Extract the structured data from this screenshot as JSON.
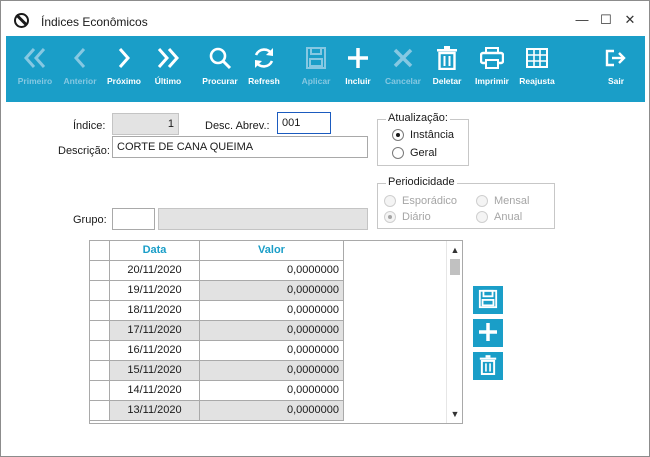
{
  "window": {
    "title": "Índices Econômicos",
    "controls": {
      "minimize": "—",
      "maximize": "☐",
      "close": "✕"
    }
  },
  "toolbar": {
    "items": [
      {
        "label": "Primeiro",
        "icon": "double-chevron-left-icon",
        "enabled": false
      },
      {
        "label": "Anterior",
        "icon": "chevron-left-icon",
        "enabled": false
      },
      {
        "label": "Próximo",
        "icon": "chevron-right-icon",
        "enabled": true
      },
      {
        "label": "Último",
        "icon": "double-chevron-right-icon",
        "enabled": true
      },
      {
        "label": "Procurar",
        "icon": "search-icon",
        "enabled": true
      },
      {
        "label": "Refresh",
        "icon": "refresh-icon",
        "enabled": true
      },
      {
        "label": "Aplicar",
        "icon": "save-icon",
        "enabled": false
      },
      {
        "label": "Incluir",
        "icon": "plus-icon",
        "enabled": true
      },
      {
        "label": "Cancelar",
        "icon": "x-icon",
        "enabled": false
      },
      {
        "label": "Deletar",
        "icon": "trash-icon",
        "enabled": true
      },
      {
        "label": "Imprimir",
        "icon": "printer-icon",
        "enabled": true
      },
      {
        "label": "Reajusta",
        "icon": "grid-icon",
        "enabled": true
      },
      {
        "label": "Sair",
        "icon": "exit-icon",
        "enabled": true
      }
    ]
  },
  "form": {
    "indice_label": "Índice:",
    "indice_value": "1",
    "desc_abrev_label": "Desc. Abrev.:",
    "desc_abrev_value": "001",
    "descricao_label": "Descrição:",
    "descricao_value": "CORTE DE CANA QUEIMA",
    "grupo_label": "Grupo:",
    "grupo_code": "",
    "grupo_desc": ""
  },
  "atualizacao": {
    "title": "Atualização:",
    "options": [
      {
        "label": "Instância",
        "checked": true
      },
      {
        "label": "Geral",
        "checked": false
      }
    ]
  },
  "periodicidade": {
    "title": "Periodicidade",
    "options": [
      {
        "label": "Esporádico",
        "checked": false
      },
      {
        "label": "Mensal",
        "checked": false
      },
      {
        "label": "Diário",
        "checked": true
      },
      {
        "label": "Anual",
        "checked": false
      }
    ]
  },
  "grid": {
    "columns": [
      "Data",
      "Valor"
    ],
    "rows": [
      {
        "data": "20/11/2020",
        "valor": "0,0000000"
      },
      {
        "data": "19/11/2020",
        "valor": "0,0000000"
      },
      {
        "data": "18/11/2020",
        "valor": "0,0000000"
      },
      {
        "data": "17/11/2020",
        "valor": "0,0000000"
      },
      {
        "data": "16/11/2020",
        "valor": "0,0000000"
      },
      {
        "data": "15/11/2020",
        "valor": "0,0000000"
      },
      {
        "data": "14/11/2020",
        "valor": "0,0000000"
      },
      {
        "data": "13/11/2020",
        "valor": "0,0000000"
      }
    ],
    "scroll_up": "▲",
    "scroll_down": "▼"
  },
  "side_actions": [
    {
      "name": "save",
      "icon": "save-icon"
    },
    {
      "name": "add",
      "icon": "plus-icon"
    },
    {
      "name": "delete",
      "icon": "trash-icon"
    }
  ],
  "colors": {
    "toolbar": "#1a9ec8",
    "toolbar_text": "#ffffff",
    "toolbar_disabled_text": "#86c8e2",
    "header_text": "#1a9ec8",
    "alt_row": "#e2e2e2"
  }
}
